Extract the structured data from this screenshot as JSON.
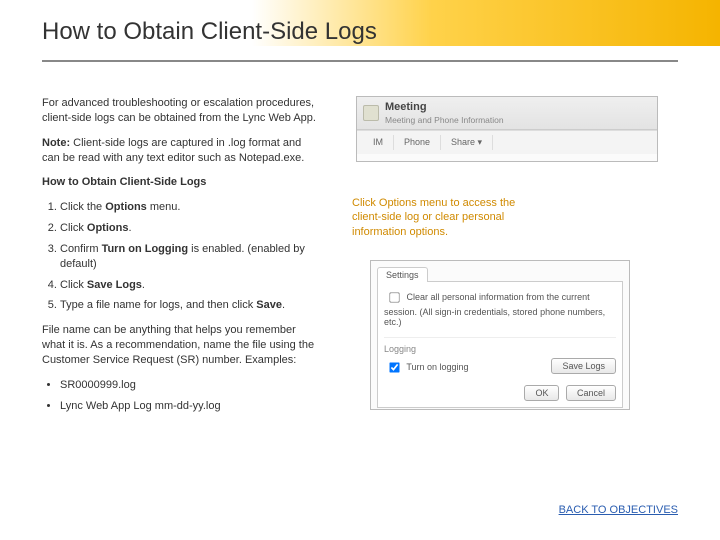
{
  "title": "How to Obtain Client-Side Logs",
  "intro": "For advanced troubleshooting or escalation procedures, client-side logs can be obtained from the Lync Web App.",
  "note_label": "Note:",
  "note_body": " Client-side logs are captured in .log format and can be read with any text editor such as Notepad.exe.",
  "subhead": "How to Obtain Client-Side Logs",
  "steps": {
    "s1a": "Click the ",
    "s1b": "Options",
    "s1c": " menu.",
    "s2a": "Click ",
    "s2b": "Options",
    "s2c": ".",
    "s3a": "Confirm ",
    "s3b": "Turn on Logging",
    "s3c": " is enabled. (enabled by default)",
    "s4a": "Click ",
    "s4b": "Save Logs",
    "s4c": ".",
    "s5a": "Type a file name for logs, and then click ",
    "s5b": "Save",
    "s5c": "."
  },
  "filename_tip": "File name can be anything that helps you remember what it is. As a recommendation, name the file using the Customer Service Request (SR) number. Examples:",
  "examples": {
    "e1": "SR0000999.log",
    "e2": "Lync Web App Log mm-dd-yy.log"
  },
  "callout": "Click Options menu to access the client-side log or clear personal information options.",
  "backlink": "BACK TO OBJECTIVES",
  "mock1": {
    "meeting": "Meeting",
    "meeting_sub": "Meeting and Phone Information",
    "tab1": "IM",
    "tab2": "Phone",
    "tab3": "Share ▾"
  },
  "mock2": {
    "tab": "Settings",
    "clear": "Clear all personal information from the current session. (All sign-in credentials, stored phone numbers, etc.)",
    "section": "Logging",
    "turn_on": "Turn on logging",
    "save_logs": "Save Logs",
    "ok": "OK",
    "cancel": "Cancel"
  }
}
